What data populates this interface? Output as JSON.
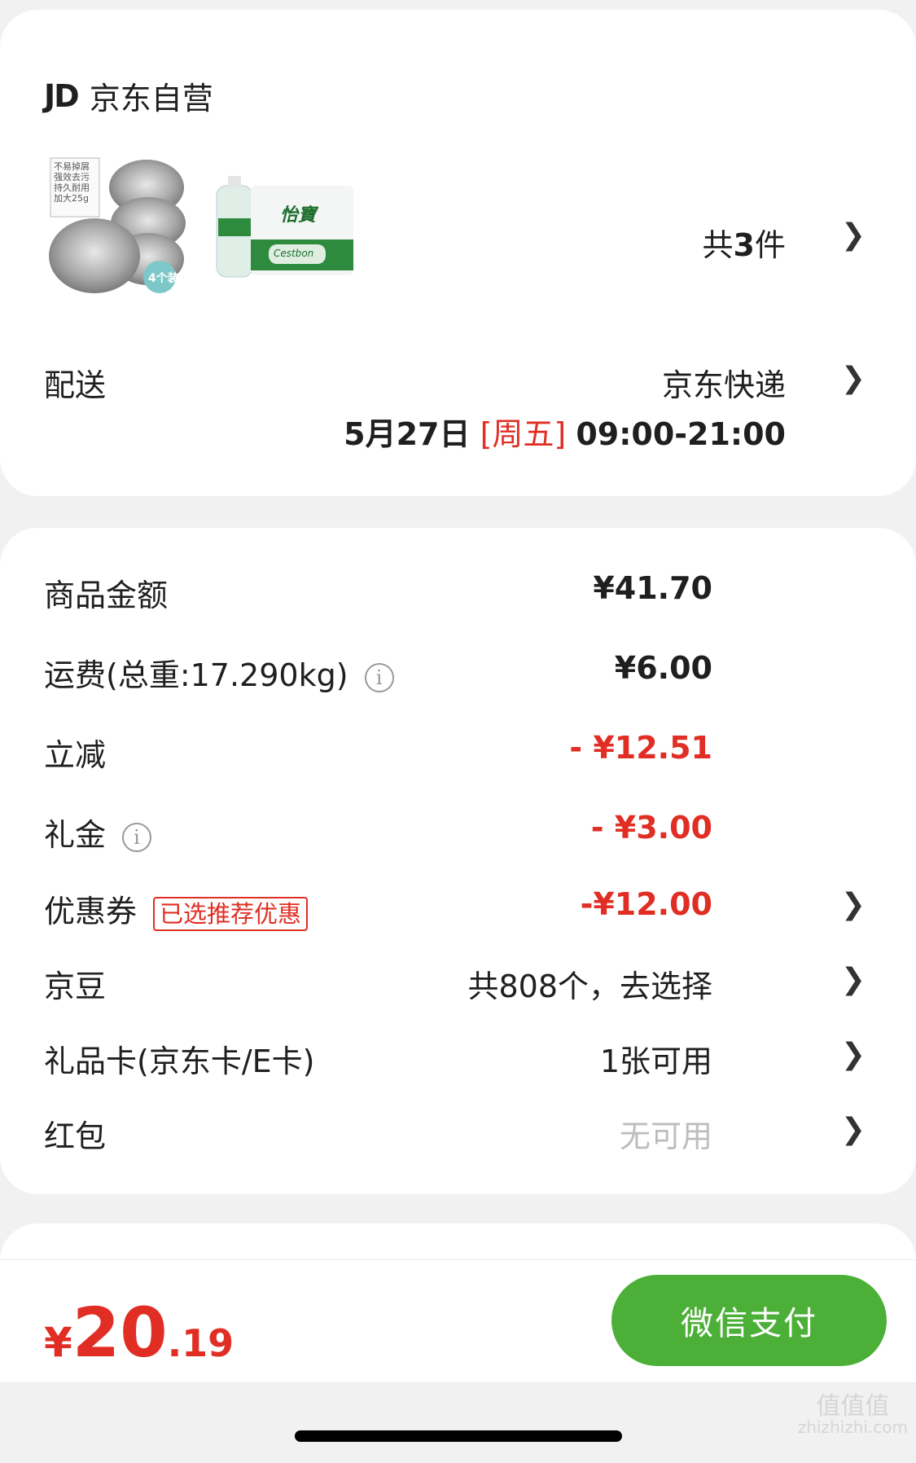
{
  "shop": {
    "logo": "JD",
    "name": "京东自营",
    "item_count_prefix": "共",
    "item_count": "3",
    "item_count_suffix": "件",
    "thumb1_text": [
      "不易掉屑",
      "强效去污",
      "持久耐用",
      "加大25g"
    ],
    "thumb1_badge": "4个装",
    "thumb2_brand": "怡寶",
    "thumb2_sub": "Cestbon"
  },
  "delivery": {
    "label": "配送",
    "method": "京东快递",
    "date": "5月27日",
    "weekday": "[周五]",
    "time": "09:00-21:00"
  },
  "summary": {
    "goods_label": "商品金额",
    "goods_value": "¥41.70",
    "shipping_label": "运费(总重:17.290kg)",
    "shipping_value": "¥6.00",
    "instant_label": "立减",
    "instant_value": "- ¥12.51",
    "gift_money_label": "礼金",
    "gift_money_value": "- ¥3.00",
    "coupon_label": "优惠券",
    "coupon_tag": "已选推荐优惠",
    "coupon_value": "-¥12.00",
    "beans_label": "京豆",
    "beans_value": "共808个，去选择",
    "giftcard_label": "礼品卡(京东卡/E卡)",
    "giftcard_value": "1张可用",
    "redpacket_label": "红包",
    "redpacket_value": "无可用"
  },
  "footer": {
    "currency": "¥",
    "total_int": "20",
    "total_dec": ".19",
    "pay_button": "微信支付"
  },
  "watermark": {
    "text": "值值值",
    "url": "zhizhizhi.com"
  },
  "icons": {
    "chevron": "chevron-right-icon",
    "info": "info-icon"
  },
  "colors": {
    "accent_red": "#e02e24",
    "pay_green": "#4caf38"
  }
}
